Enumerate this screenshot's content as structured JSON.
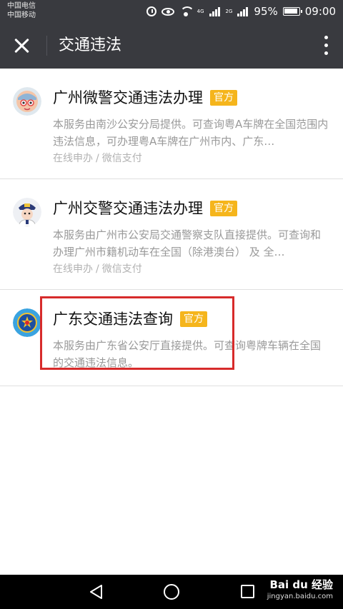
{
  "status_bar": {
    "carrier_1": "中国电信",
    "carrier_2": "中国移动",
    "network_1": "4G",
    "network_2": "2G",
    "battery": "95%",
    "time": "09:00",
    "icons": [
      "alarm-icon",
      "eye-icon",
      "wifi-icon",
      "signal-icon",
      "battery-icon"
    ]
  },
  "header": {
    "title": "交通违法",
    "close_icon": "close-icon",
    "more_icon": "more-vertical-icon",
    "background": "#393a3f"
  },
  "items": [
    {
      "title": "广州微警交通违法办理",
      "badge": "官方",
      "description": "本服务由南沙公安分局提供。可查询粤A车牌在全国范围内违法信息，可办理粤A车牌在广州市内、广东…",
      "tags": [
        "在线申办",
        "微信支付"
      ]
    },
    {
      "title": "广州交警交通违法办理",
      "badge": "官方",
      "description": "本服务由广州市公安局交通警察支队直接提供。可查询和办理广州市籍机动车在全国（除港澳台） 及 全…",
      "tags": [
        "在线申办",
        "微信支付"
      ]
    },
    {
      "title": "广东交通违法查询",
      "badge": "官方",
      "description": "本服务由广东省公安厅直接提供。可查询粤牌车辆在全国的交通违法信息。",
      "tags": []
    }
  ],
  "colors": {
    "badge": "#f5b51c",
    "highlight": "#d72b2b",
    "title_text": "#111111",
    "desc_text": "#999999"
  },
  "nav": {
    "watermark_logo": "Bai du 经验",
    "watermark_url": "jingyan.baidu.com"
  }
}
